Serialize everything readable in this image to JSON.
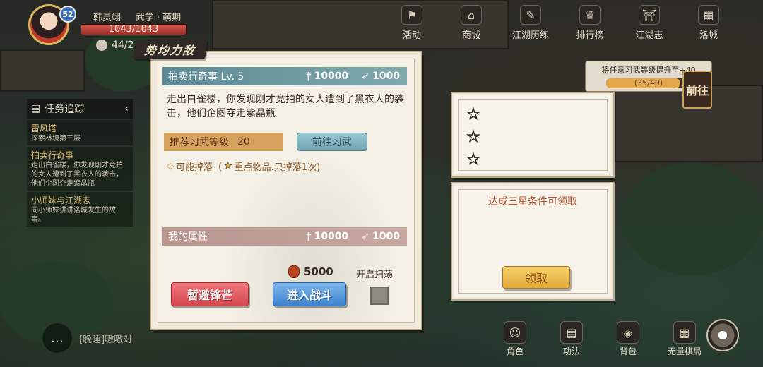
{
  "player": {
    "name": "韩灵翊",
    "title": "武学 · 萌期",
    "level": "52",
    "hp": "1043/1043",
    "stamina": "44/2"
  },
  "topnav": [
    {
      "label": "活动",
      "icon": "flag-icon",
      "glyph": "⚑"
    },
    {
      "label": "商城",
      "icon": "shop-icon",
      "glyph": "⌂"
    },
    {
      "label": "江湖历练",
      "icon": "scroll-icon",
      "glyph": "✎"
    },
    {
      "label": "排行榜",
      "icon": "trophy-icon",
      "glyph": "♛"
    },
    {
      "label": "江湖志",
      "icon": "pavilion-icon",
      "glyph": "⛩"
    },
    {
      "label": "洛城",
      "icon": "city-gate-icon",
      "glyph": "▦"
    }
  ],
  "tracker": {
    "title": "任务追踪",
    "quests": [
      {
        "title": "雷风塔",
        "desc": "探索林境第三层"
      },
      {
        "title": "拍卖行奇事",
        "desc": "走出白雀楼，你发现刚才竞拍的女人遭到了黑衣人的袭击，他们企图夺走紫晶瓶"
      },
      {
        "title": "小师妹与江湖志",
        "desc": "同小师妹讲讲洛城发生的故事。"
      }
    ]
  },
  "objective": {
    "text": "将任意习武等级提升至+40",
    "progress_text": "(35/40)",
    "progress": 0.875,
    "go_label": "前往"
  },
  "panel": {
    "tag": "势均力敌",
    "title": "拍卖行奇事 Lv. 5",
    "enemy_attack": "10000",
    "enemy_speed": "1000",
    "description": "走出白雀楼，你发现刚才竞拍的女人遭到了黑衣人的袭击，他们企图夺走紫晶瓶",
    "recommend_label": "推荐习武等级",
    "recommend_level": "20",
    "goto_training": "前往习武",
    "drops_label": "可能掉落（",
    "drops_note": "重点物品.只掉落1次)",
    "mystats_label": "我的属性",
    "my_attack": "10000",
    "my_speed": "1000",
    "cost": "5000",
    "sweep_label": "开启扫荡",
    "retreat": "暂避锋芒",
    "fight": "进入战斗"
  },
  "reward": {
    "condition": "达成三星条件可领取",
    "claim": "领取"
  },
  "chat": {
    "text": "[晚睡]嗷嗷对"
  },
  "botnav": [
    {
      "label": "角色",
      "icon": "character-icon",
      "glyph": "☺"
    },
    {
      "label": "功法",
      "icon": "book-icon",
      "glyph": "▤"
    },
    {
      "label": "背包",
      "icon": "bag-icon",
      "glyph": "◈"
    },
    {
      "label": "无量棋局",
      "icon": "chessboard-icon",
      "glyph": "▦"
    }
  ],
  "colors": {
    "accent_teal": "#5c8a94",
    "accent_rose": "#b99590",
    "warn_red": "#d4474c",
    "action_blue": "#3d83cf",
    "gold": "#e1a83a"
  }
}
